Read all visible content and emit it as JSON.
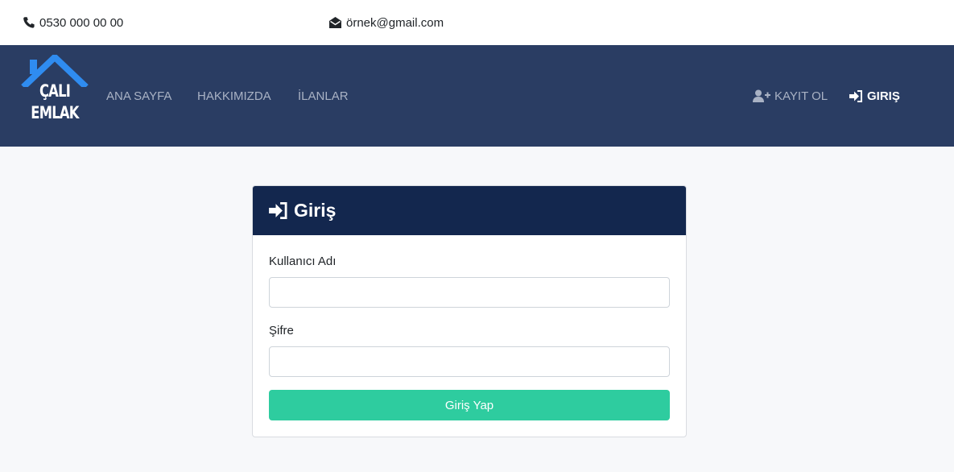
{
  "topbar": {
    "phone": "0530 000 00 00",
    "email": "örnek@gmail.com",
    "phone_icon": "phone-icon",
    "email_icon": "envelope-open-icon"
  },
  "brand": {
    "line1": "ÇALI",
    "line2": "EMLAK",
    "accent": "#2f8cf0"
  },
  "nav": {
    "items": [
      {
        "label": "ANA SAYFA"
      },
      {
        "label": "HAKKIMIZDA"
      },
      {
        "label": "İLANLAR"
      }
    ],
    "register": {
      "label": "KAYIT OL",
      "icon": "user-plus-icon"
    },
    "login": {
      "label": "GIRIŞ",
      "icon": "sign-in-icon"
    }
  },
  "login_card": {
    "title": "Giriş",
    "title_icon": "sign-in-icon",
    "username_label": "Kullanıcı Adı",
    "username_value": "",
    "password_label": "Şifre",
    "password_value": "",
    "submit_label": "Giriş Yap"
  },
  "colors": {
    "navbar": "#2a3d63",
    "card_header": "#13274e",
    "submit": "#2ecc9f"
  }
}
